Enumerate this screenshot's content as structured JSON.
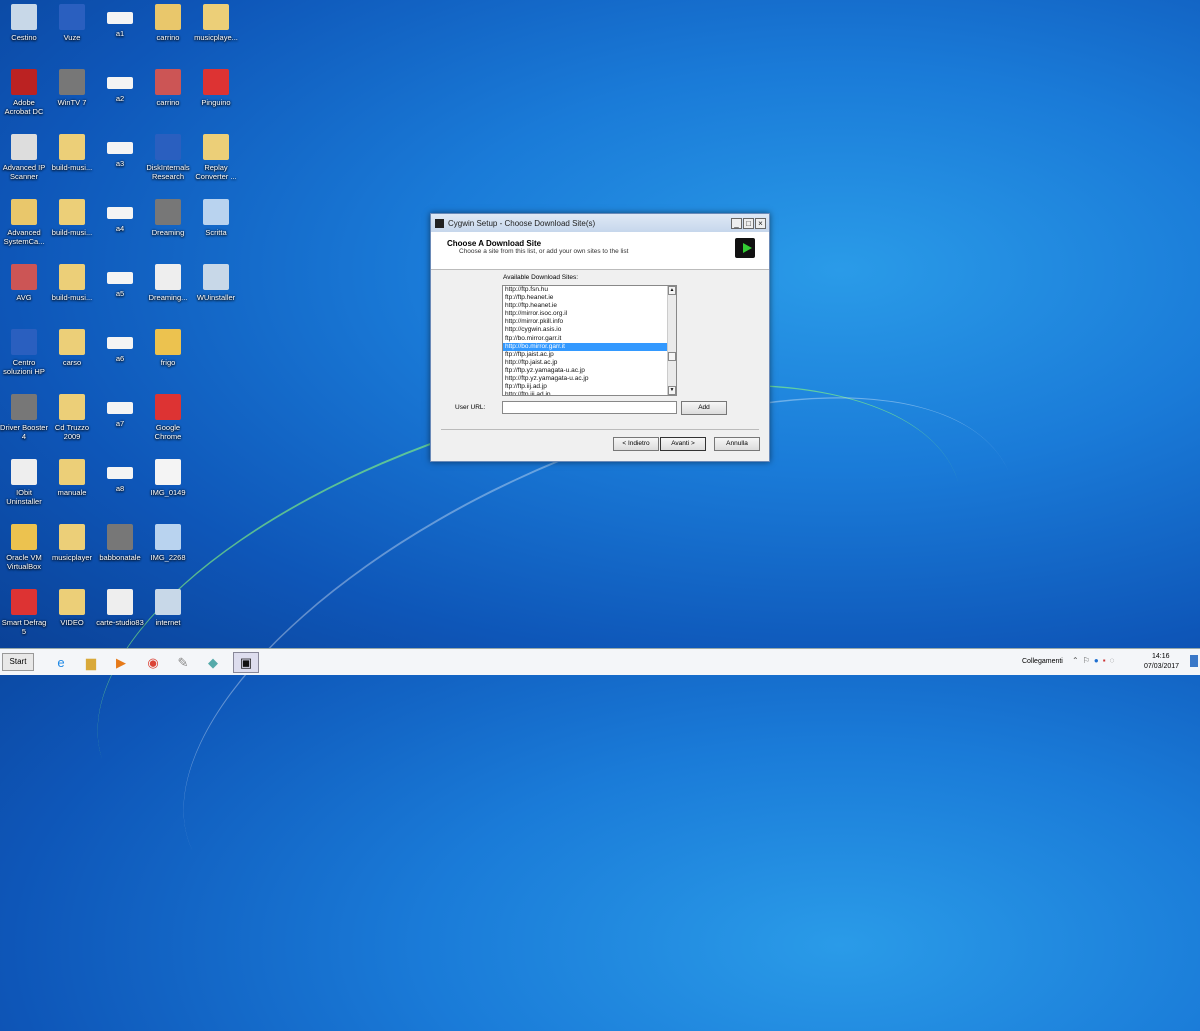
{
  "desktop": {
    "icons": [
      [
        "Cestino",
        "Vuze",
        "a1",
        "carrino",
        "musicplaye..."
      ],
      [
        "Adobe Acrobat DC",
        "WinTV 7",
        "a2",
        "carrino",
        "Pinguino"
      ],
      [
        "Advanced IP Scanner",
        "build-musi...",
        "a3",
        "DiskInternals Research",
        "Replay Converter ..."
      ],
      [
        "Advanced SystemCa...",
        "build-musi...",
        "a4",
        "Dreaming",
        "Scritta"
      ],
      [
        "AVG",
        "build-musi...",
        "a5",
        "Dreaming...",
        "WUinstaller"
      ],
      [
        "Centro soluzioni HP",
        "carso",
        "a6",
        "frigo"
      ],
      [
        "Driver Booster 4",
        "Cd Truzzo 2009",
        "a7",
        "Google Chrome"
      ],
      [
        "IObit Uninstaller",
        "manuale",
        "a8",
        "IMG_0149"
      ],
      [
        "Oracle VM VirtualBox",
        "musicplayer",
        "babbonatale",
        "IMG_2268"
      ],
      [
        "Smart Defrag 5",
        "VIDEO",
        "carte-studio83",
        "internet"
      ]
    ]
  },
  "dialog": {
    "title": "Cygwin Setup - Choose Download Site(s)",
    "heading": "Choose A Download Site",
    "subheading": "Choose a site from this list, or add your own sites to the list",
    "list_label": "Available Download Sites:",
    "sites": [
      "http://ftp.fsn.hu",
      "ftp://ftp.heanet.ie",
      "http://ftp.heanet.ie",
      "http://mirror.isoc.org.il",
      "http://mirror.pkill.info",
      "http://cygwin.asis.io",
      "ftp://bo.mirror.garr.it",
      "http://bo.mirror.garr.it",
      "ftp://ftp.jaist.ac.jp",
      "http://ftp.jaist.ac.jp",
      "ftp://ftp.yz.yamagata-u.ac.jp",
      "http://ftp.yz.yamagata-u.ac.jp",
      "ftp://ftp.iij.ad.jp",
      "http://ftp.iij.ad.jp"
    ],
    "selected_index": 7,
    "user_url_label": "User URL:",
    "user_url_value": "",
    "add_label": "Add",
    "back_label": "< Indietro",
    "next_label": "Avanti >",
    "cancel_label": "Annulla"
  },
  "taskbar": {
    "start_label": "Start",
    "toolbar_label": "Collegamenti",
    "time": "14:16",
    "date": "07/03/2017"
  }
}
